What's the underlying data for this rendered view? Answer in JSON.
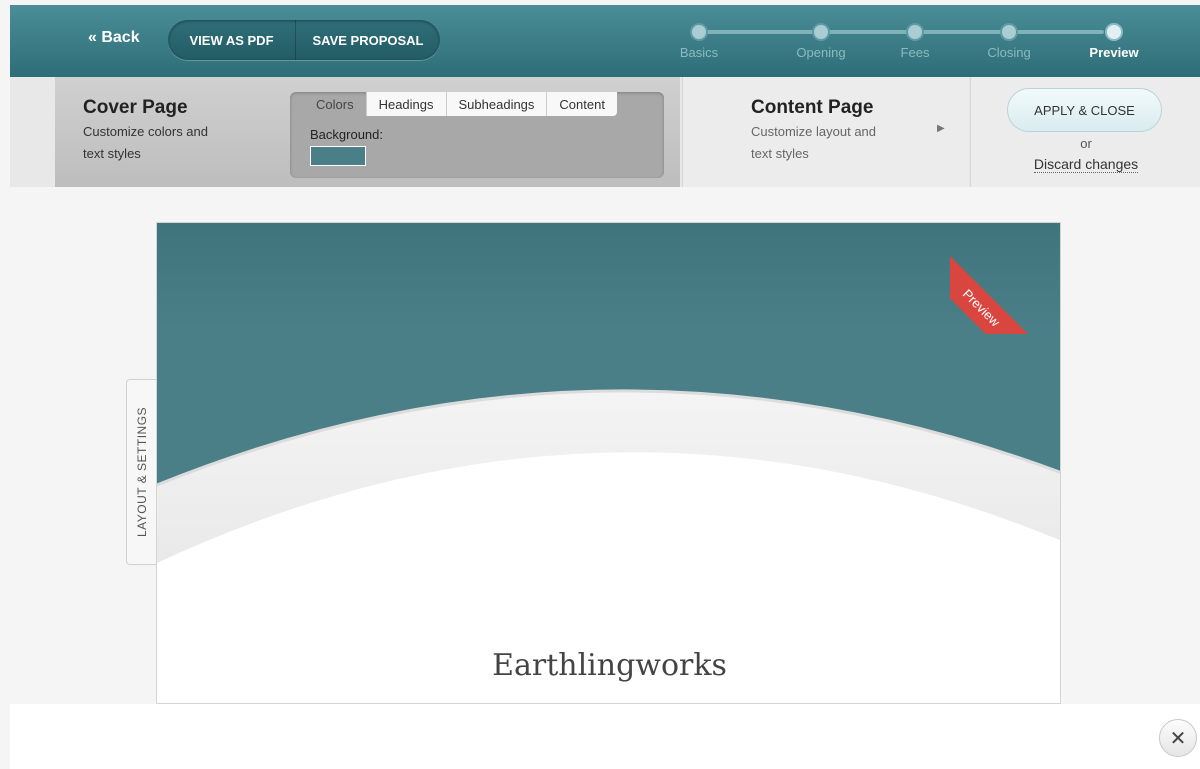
{
  "header": {
    "back_label": "« Back",
    "view_pdf_label": "VIEW AS PDF",
    "save_label": "SAVE PROPOSAL",
    "steps": [
      {
        "label": "Basics",
        "active": false
      },
      {
        "label": "Opening",
        "active": false
      },
      {
        "label": "Fees",
        "active": false
      },
      {
        "label": "Closing",
        "active": false
      },
      {
        "label": "Preview",
        "active": true
      }
    ]
  },
  "cover_panel": {
    "title": "Cover Page",
    "description": "Customize colors and text styles",
    "tabs": [
      "Colors",
      "Headings",
      "Subheadings",
      "Content"
    ],
    "selected_tab": "Colors",
    "background_label": "Background:",
    "background_color": "#4a7f88"
  },
  "content_panel": {
    "title": "Content Page",
    "description": "Customize layout and text styles",
    "arrow": "▶"
  },
  "actions": {
    "apply_label": "APPLY & CLOSE",
    "or_label": "or",
    "discard_label": "Discard changes"
  },
  "preview": {
    "ribbon_label": "Preview",
    "company_name": "Earthlingworks",
    "side_tab_label": "LAYOUT & SETTINGS",
    "header_color": "#4a7f88",
    "ribbon_color": "#d9453f"
  },
  "close_label": "✕"
}
